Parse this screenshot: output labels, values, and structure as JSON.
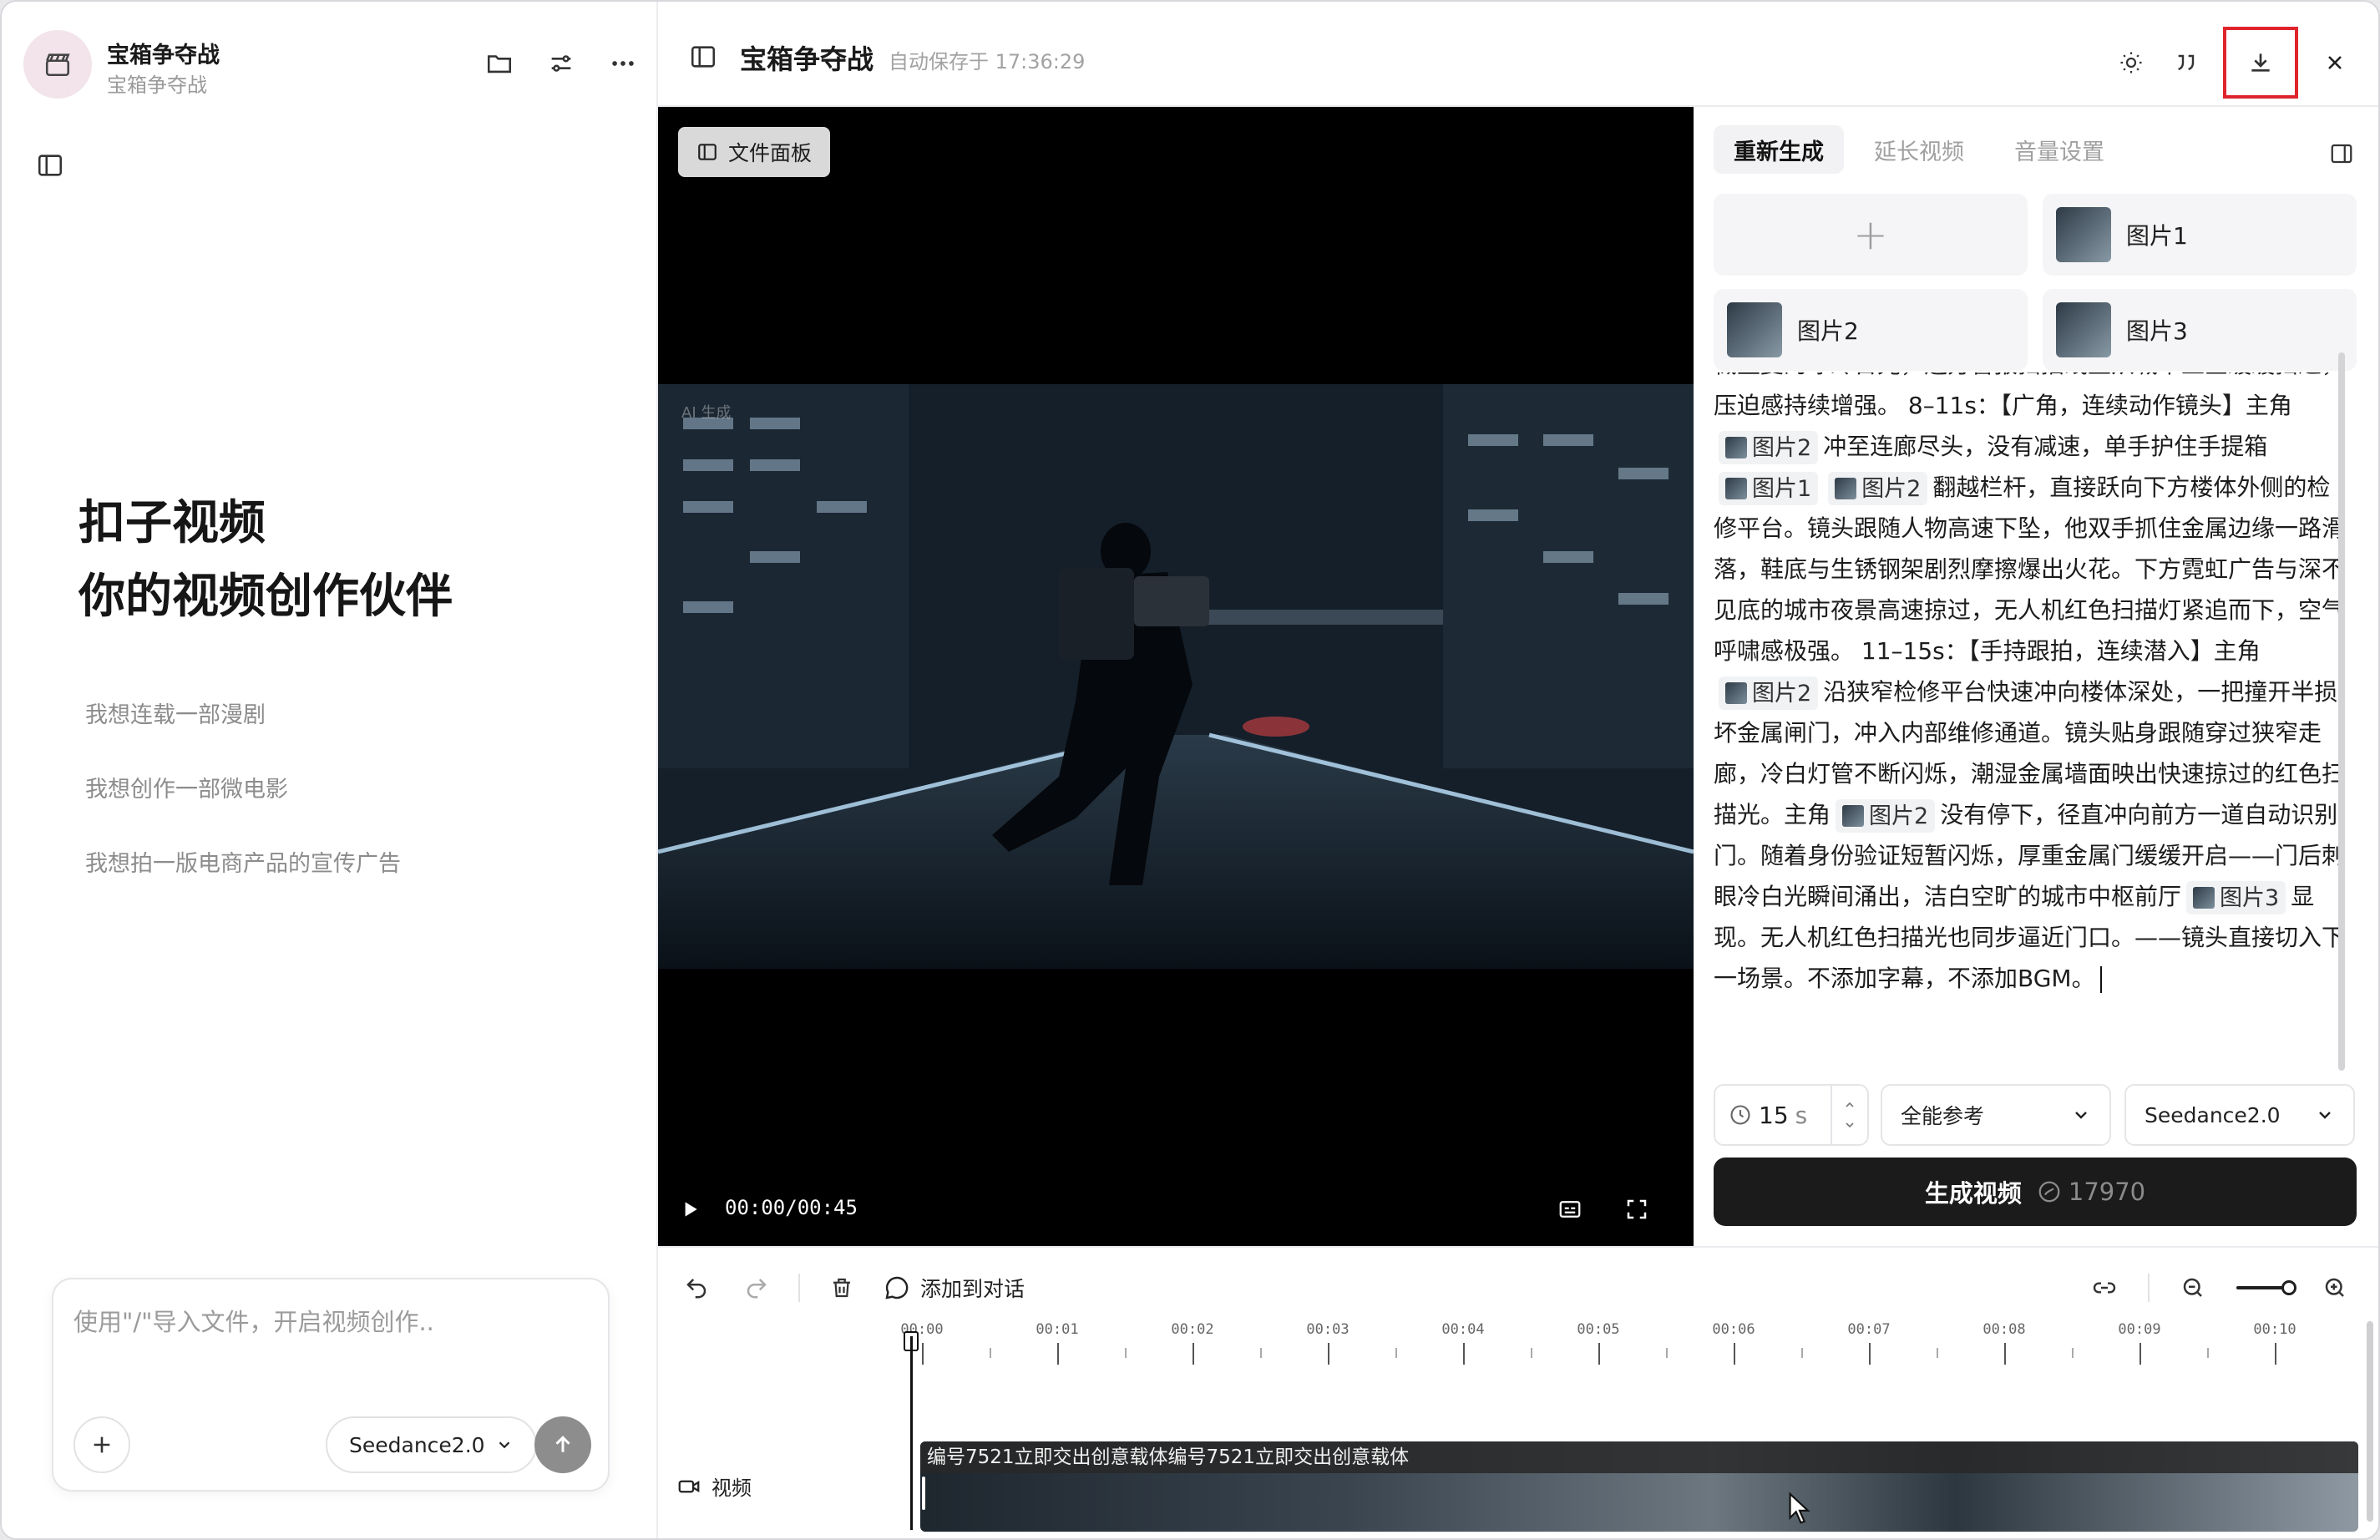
{
  "project": {
    "title": "宝箱争夺战",
    "subtitle": "宝箱争夺战"
  },
  "sidebar": {
    "hero_line1": "扣子视频",
    "hero_line2": "你的视频创作伙伴",
    "suggestions": [
      "我想连载一部漫剧",
      "我想创作一部微电影",
      "我想拍一版电商产品的宣传广告"
    ],
    "chat_placeholder": "使用\"/\"导入文件，开启视频创作..",
    "model_label": "Seedance2.0"
  },
  "topbar": {
    "title": "宝箱争夺战",
    "autosave": "自动保存于 17:36:29"
  },
  "video": {
    "file_panel_label": "文件面板",
    "time": "00:00/00:45",
    "ai_watermark": "AI 生成"
  },
  "right_panel": {
    "tabs": [
      {
        "label": "重新生成",
        "active": true
      },
      {
        "label": "延长视频",
        "active": false
      },
      {
        "label": "音量设置",
        "active": false
      }
    ],
    "add_symbol": "+",
    "refs": [
      "图片1",
      "图片2",
      "图片3"
    ],
    "prompt": {
      "p01": "械重复的冰冷日光，远方警报扫描线正从城市上空缓缓扫过，压迫感持续增强。 8–11s：【广角，连续动作镜头】主角",
      "p02": "冲至连廊尽头，没有减速，单手护住手提箱",
      "p03": "翻越栏杆，直接跃向下方楼体外侧的检修平台。镜头跟随人物高速下坠，他双手抓住金属边缘一路滑落，鞋底与生锈钢架剧烈摩擦爆出火花。下方霓虹广告与深不见底的城市夜景高速掠过，无人机红色扫描灯紧追而下，空气呼啸感极强。 11–15s：【手持跟拍，连续潜入】主角",
      "p04": "沿狭窄检修平台快速冲向楼体深处，一把撞开半损坏金属闸门，冲入内部维修通道。镜头贴身跟随穿过狭窄走廊，冷白灯管不断闪烁，潮湿金属墙面映出快速掠过的红色扫描光。主角",
      "p05": "没有停下，径直冲向前方一道自动识别门。随着身份验证短暂闪烁，厚重金属门缓缓开启——门后刺眼冷白光瞬间涌出，洁白空旷的城市中枢前厅",
      "p06": "显现。无人机红色扫描光也同步逼近门口。——镜头直接切入下一场景。不添加字幕，不添加BGM。"
    },
    "duration_value": "15",
    "duration_unit": "s",
    "reference_mode": "全能参考",
    "model": "Seedance2.0",
    "generate_label": "生成视频",
    "generate_cost": "17970"
  },
  "timeline": {
    "add_to_chat": "添加到对话",
    "ticks": [
      "00:00",
      "00:01",
      "00:02",
      "00:03",
      "00:04",
      "00:05",
      "00:06",
      "00:07",
      "00:08",
      "00:09",
      "00:10"
    ],
    "track_label": "视频",
    "clip_title": "编号7521立即交出创意载体编号7521立即交出创意载体"
  },
  "colors": {
    "accent_highlight": "#e0242b",
    "primary_button": "#1b1b1b"
  }
}
